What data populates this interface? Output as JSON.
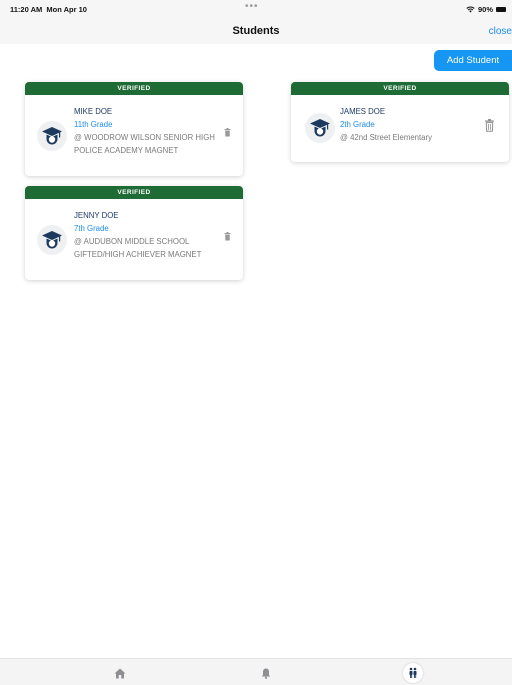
{
  "status_bar": {
    "time": "11:20 AM",
    "date": "Mon Apr 10",
    "dots": "•••",
    "battery": "90%",
    "icons": [
      "wifi-icon",
      "battery-icon"
    ]
  },
  "nav": {
    "title": "Students",
    "close_label": "close"
  },
  "actions": {
    "add_student_label": "Add Student"
  },
  "students": [
    {
      "status": "VERIFIED",
      "name": "MIKE DOE",
      "grade": "11th Grade",
      "school_line1": "@ WOODROW WILSON SENIOR HIGH",
      "school_line2": "POLICE ACADEMY MAGNET",
      "icon": "graduate-icon"
    },
    {
      "status": "VERIFIED",
      "name": "JAMES DOE",
      "grade": "2th Grade",
      "school_line1": "@ 42nd Street Elementary",
      "school_line2": "",
      "icon": "graduate-icon"
    },
    {
      "status": "VERIFIED",
      "name": "JENNY DOE",
      "grade": "7th Grade",
      "school_line1": "@ AUDUBON MIDDLE SCHOOL",
      "school_line2": "GIFTED/HIGH ACHIEVER MAGNET",
      "icon": "graduate-icon"
    }
  ],
  "tab_bar": {
    "tabs": [
      "home-icon",
      "bell-icon",
      "family-icon"
    ],
    "active": "family-icon"
  },
  "colors": {
    "accent": "#1596f2",
    "verified_header": "#1e6b35",
    "name": "#1f3a6b",
    "grade": "#1f8cf0"
  }
}
